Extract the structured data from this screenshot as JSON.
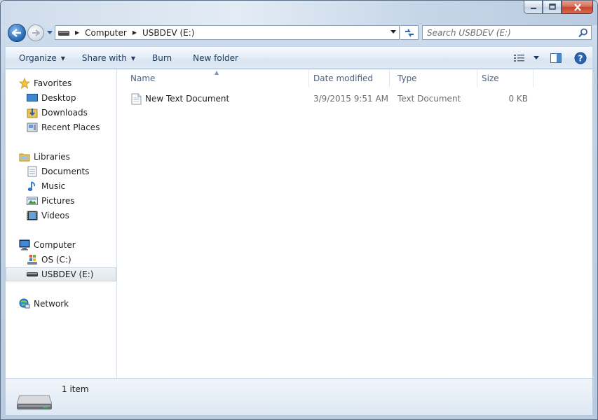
{
  "window": {
    "caption_buttons": [
      "minimize",
      "maximize",
      "close"
    ]
  },
  "address_bar": {
    "crumbs": [
      "Computer",
      "USBDEV (E:)"
    ]
  },
  "search": {
    "placeholder": "Search USBDEV (E:)"
  },
  "command_bar": {
    "organize": "Organize",
    "share_with": "Share with",
    "burn": "Burn",
    "new_folder": "New folder"
  },
  "nav_pane": {
    "favorites": {
      "label": "Favorites",
      "items": [
        "Desktop",
        "Downloads",
        "Recent Places"
      ]
    },
    "libraries": {
      "label": "Libraries",
      "items": [
        "Documents",
        "Music",
        "Pictures",
        "Videos"
      ]
    },
    "computer": {
      "label": "Computer",
      "items": [
        "OS (C:)",
        "USBDEV (E:)"
      ],
      "selected": "USBDEV (E:)"
    },
    "network": {
      "label": "Network"
    }
  },
  "file_list": {
    "columns": [
      "Name",
      "Date modified",
      "Type",
      "Size"
    ],
    "sort_column": "Name",
    "rows": [
      {
        "name": "New Text Document",
        "date_modified": "3/9/2015 9:51 AM",
        "type": "Text Document",
        "size": "0 KB"
      }
    ]
  },
  "status_bar": {
    "item_count": "1 item"
  },
  "colors": {
    "window_frame": "#c2d3e6",
    "command_bar_text": "#1e395b",
    "column_header_text": "#4d6185",
    "secondary_text": "#6d6d6d",
    "selected_item_bg": "#e1e8ef"
  }
}
